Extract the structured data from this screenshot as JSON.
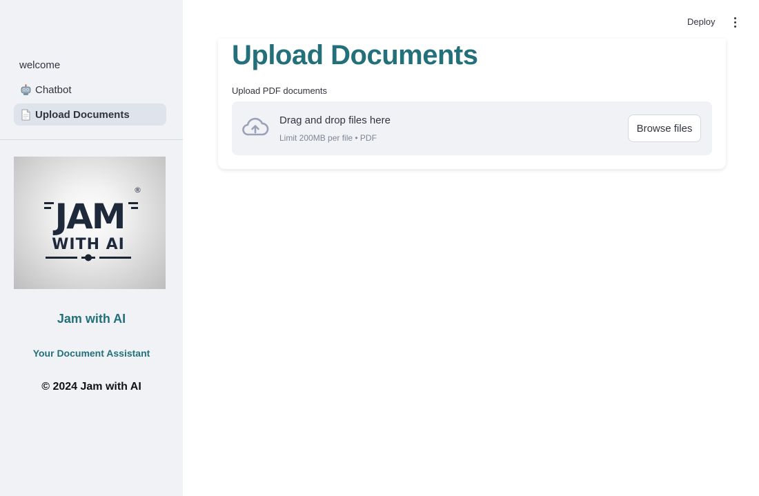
{
  "sidebar": {
    "nav": [
      {
        "label": "welcome",
        "icon": "none",
        "active": false
      },
      {
        "label": "Chatbot",
        "icon": "robot-icon",
        "active": false
      },
      {
        "label": "Upload Documents",
        "icon": "page-icon",
        "active": true
      }
    ],
    "logo": {
      "line1": "JAM",
      "line2": "WITH AI",
      "mark": "®"
    },
    "brand_title": "Jam with AI",
    "brand_subtitle": "Your Document Assistant",
    "copyright": "© 2024 Jam with AI"
  },
  "header": {
    "deploy_label": "Deploy",
    "menu_icon": "kebab-menu-icon"
  },
  "main": {
    "title": "Upload Documents",
    "uploader": {
      "label": "Upload PDF documents",
      "drop_text": "Drag and drop files here",
      "limit_text": "Limit 200MB per file • PDF",
      "browse_label": "Browse files",
      "icon": "cloud-upload-icon"
    }
  },
  "colors": {
    "accent": "#23707a",
    "sidebar_bg": "#f0f2f6",
    "active_nav_bg": "#dfe3ec",
    "dropzone_bg": "#f0f2f6"
  }
}
